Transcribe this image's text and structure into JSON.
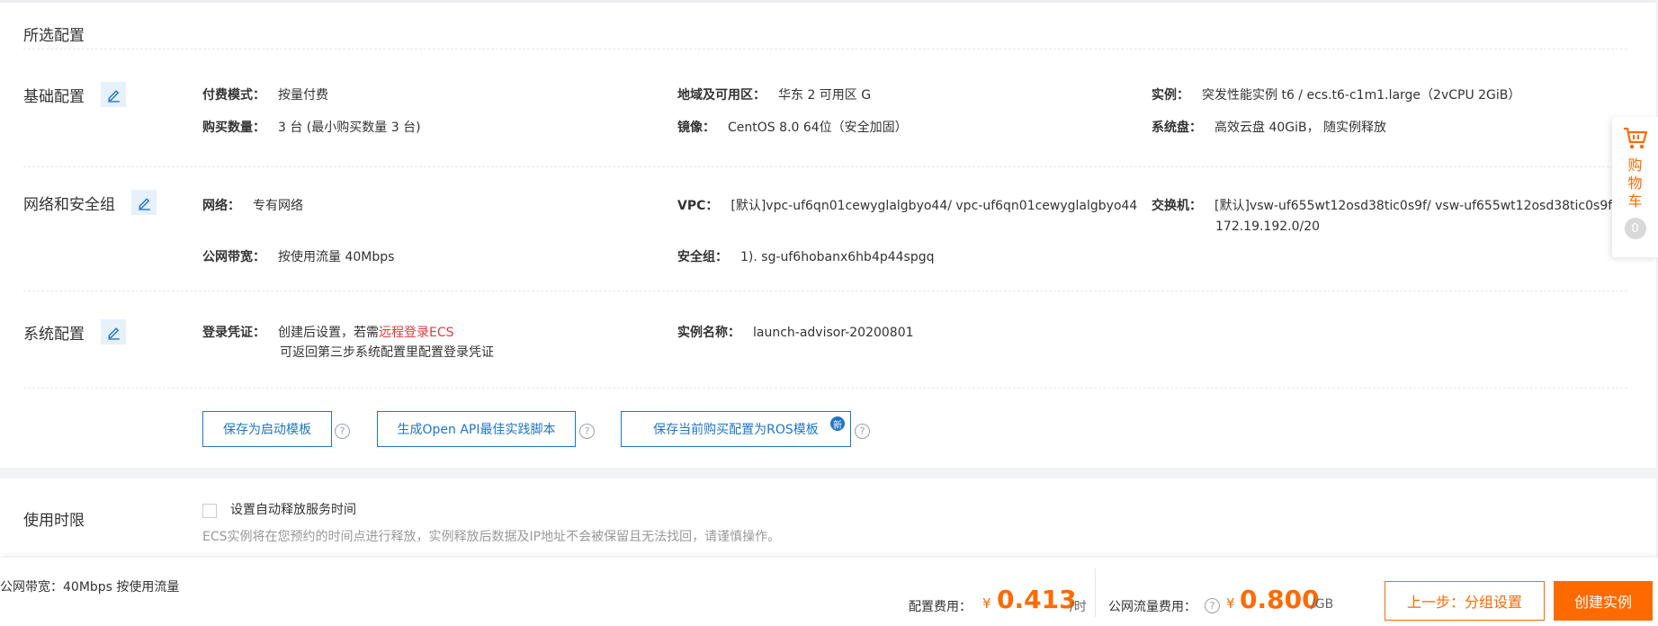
{
  "panel_title": "所选配置",
  "sections": {
    "basic": "基础配置",
    "network": "网络和安全组",
    "system": "系统配置"
  },
  "fields": {
    "billing_k": "付费模式：",
    "billing_v": "按量付费",
    "qty_k": "购买数量：",
    "qty_v": "3 台 (最小购买数量 3 台)",
    "region_k": "地域及可用区：",
    "region_v": "华东 2 可用区 G",
    "image_k": "镜像：",
    "image_v": "CentOS 8.0 64位（安全加固）",
    "instance_k": "实例：",
    "instance_v": "突发性能实例 t6 / ecs.t6-c1m1.large（2vCPU 2GiB）",
    "disk_k": "系统盘：",
    "disk_v": "高效云盘 40GiB， 随实例释放",
    "net_k": "网络：",
    "net_v": "专有网络",
    "bw_k": "公网带宽：",
    "bw_v": "按使用流量 40Mbps",
    "vpc_k": "VPC：",
    "vpc_v": "[默认]vpc-uf6qn01cewyglalgbyo44/ vpc-uf6qn01cewyglalgbyo44",
    "sg_k": "安全组：",
    "sg_v": "1). sg-uf6hobanx6hb4p44spgq",
    "switch_k": "交换机：",
    "switch_v1": "[默认]vsw-uf655wt12osd38tic0s9f/ vsw-uf655wt12osd38tic0s9f/",
    "switch_v2": "172.19.192.0/20",
    "login_k": "登录凭证：",
    "login_v1": "创建后设置，若需",
    "login_link": "远程登录ECS",
    "login_v2": "可返回第三步系统配置里配置登录凭证",
    "name_k": "实例名称：",
    "name_v": "launch-advisor-20200801"
  },
  "buttons": {
    "save_template": "保存为启动模板",
    "gen_api": "生成Open API最佳实践脚本",
    "save_ros": "保存当前购买配置为ROS模板",
    "new_badge": "新",
    "help": "?"
  },
  "usage": {
    "label": "使用时限",
    "checkbox_label": "设置自动释放服务时间",
    "note": "ECS实例将在您预约的时间点进行释放，实例释放后数据及IP地址不会被保留且无法找回，请谨慎操作。"
  },
  "bottom": {
    "bandwidth": "公网带宽：40Mbps 按使用流量",
    "config_label": "配置费用：",
    "currency": "¥",
    "config_price": "0.413",
    "config_unit": "/时",
    "traffic_label": "公网流量费用：",
    "traffic_price": "0.800",
    "traffic_unit": "/GB",
    "prev_button": "上一步：分组设置",
    "create_button": "创建实例"
  },
  "cart": {
    "label": "购物车",
    "count": "0"
  },
  "colors": {
    "accent": "#ff6a00",
    "link_blue": "#1f75c9",
    "red": "#e4393c"
  }
}
